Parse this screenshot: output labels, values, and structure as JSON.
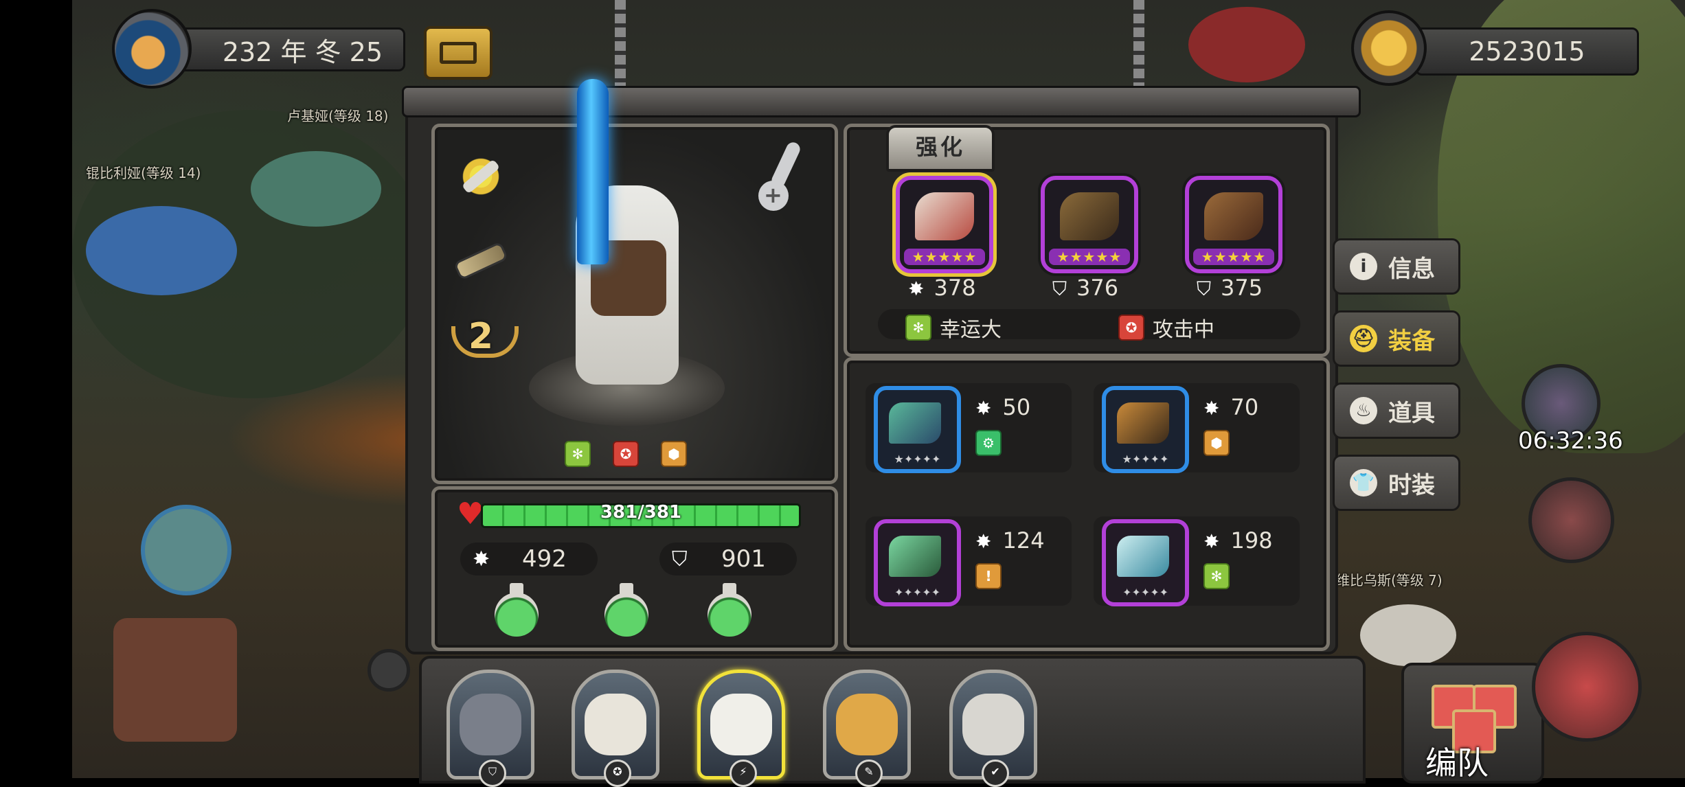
{
  "hud": {
    "date": "232 年 冬 25",
    "gold": "2523015",
    "timer": "06:32:36"
  },
  "npcs": [
    {
      "name": "卢基娅(等级 18)"
    },
    {
      "name": "锟比利娅(等级 14)"
    },
    {
      "name": "维比乌斯(等级 7)"
    }
  ],
  "hero": {
    "rank": "2",
    "badges": [
      "luck-badge",
      "attack-badge",
      "defense-badge"
    ],
    "hp_text": "381/381",
    "hp_current": 381,
    "hp_max": 381,
    "attack": "492",
    "defense": "901",
    "potions": 3
  },
  "gear": {
    "strengthen_tab": "强化",
    "slots": [
      {
        "icon": "attack-icon",
        "value": "378",
        "stars": "★★★★★",
        "rarity": "epic",
        "selected": true
      },
      {
        "icon": "defense-icon",
        "value": "376",
        "stars": "★★★★★",
        "rarity": "epic",
        "selected": false
      },
      {
        "icon": "defense-icon",
        "value": "375",
        "stars": "★★★★★",
        "rarity": "epic",
        "selected": false
      }
    ],
    "set_bonuses": [
      {
        "icon": "luck-badge",
        "label": "幸运大"
      },
      {
        "icon": "attack-badge",
        "label": "攻击中"
      }
    ]
  },
  "items": [
    {
      "value": "50",
      "rarity": "rare",
      "badge": "teal",
      "stars": "★✦✦✦✦"
    },
    {
      "value": "70",
      "rarity": "rare",
      "badge": "orange",
      "stars": "★✦✦✦✦"
    },
    {
      "value": "124",
      "rarity": "epic",
      "badge": "orange",
      "stars": "✦✦✦✦✦"
    },
    {
      "value": "198",
      "rarity": "epic",
      "badge": "green",
      "stars": "✦✦✦✦✦"
    }
  ],
  "side_tabs": [
    {
      "label": "信息",
      "icon": "info-icon",
      "active": false
    },
    {
      "label": "装备",
      "icon": "helmet-icon",
      "active": true
    },
    {
      "label": "道具",
      "icon": "potion-icon",
      "active": false
    },
    {
      "label": "时装",
      "icon": "shirt-icon",
      "active": false
    }
  ],
  "party": [
    "pirate-wolf",
    "eagle",
    "polar-bear",
    "leopard",
    "elder"
  ],
  "team_button": "编队",
  "colors": {
    "epic": "#b340d8",
    "rare": "#2f8de6",
    "accent": "#f2cf42",
    "hp": "#4ed45a"
  }
}
